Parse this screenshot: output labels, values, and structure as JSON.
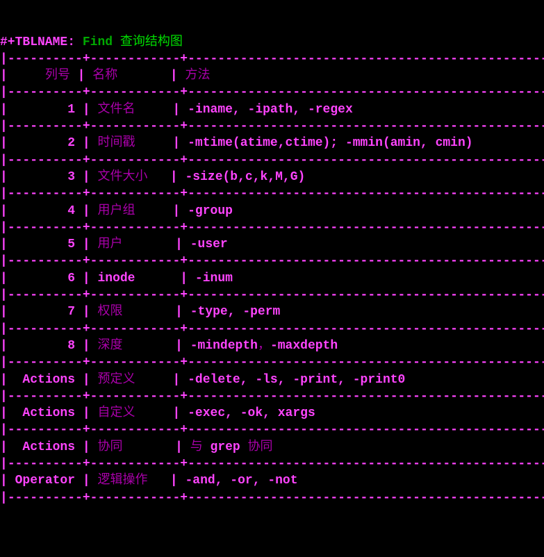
{
  "header": {
    "prefix": "#+TBLNAME:",
    "name": "Find",
    "title": "查询结构图"
  },
  "table": {
    "headers": {
      "c1": "列号",
      "c2": "名称",
      "c3": "方法"
    },
    "rows": [
      {
        "c1": "1",
        "c2": "文件名",
        "c3_a": "-iname, -ipath, -regex"
      },
      {
        "c1": "2",
        "c2": "时间戳",
        "c3_a": "-mtime(atime,ctime); -mmin(amin, cmin)"
      },
      {
        "c1": "3",
        "c2": "文件大小",
        "c3_a": "-size(b,c,k,M,G)"
      },
      {
        "c1": "4",
        "c2": "用户组",
        "c3_a": "-group"
      },
      {
        "c1": "5",
        "c2": "用户",
        "c3_a": "-user"
      },
      {
        "c1": "6",
        "c2": "inode",
        "c3_a": "-inum"
      },
      {
        "c1": "7",
        "c2": "权限",
        "c3_a": "-type, -perm"
      },
      {
        "c1": "8",
        "c2": "深度",
        "c3_a": "-mindepth",
        "c3_b": "，",
        "c3_c": "-maxdepth"
      },
      {
        "c1": "Actions",
        "c2": "预定义",
        "c3_a": "-delete, -ls, -print, -print0"
      },
      {
        "c1": "Actions",
        "c2": "自定义",
        "c3_a": "-exec, -ok, xargs"
      },
      {
        "c1": "Actions",
        "c2": "协同",
        "c3_b": "与 ",
        "c3_a": "grep",
        "c3_c": " 协同",
        "mid": true
      },
      {
        "c1": "Operator",
        "c2": "逻辑操作",
        "c3_a": "-and, -or, -not"
      }
    ]
  },
  "chart_data": {
    "type": "table",
    "title": "Find 查询结构图",
    "columns": [
      "列号",
      "名称",
      "方法"
    ],
    "rows": [
      [
        "1",
        "文件名",
        "-iname, -ipath, -regex"
      ],
      [
        "2",
        "时间戳",
        "-mtime(atime,ctime); -mmin(amin, cmin)"
      ],
      [
        "3",
        "文件大小",
        "-size(b,c,k,M,G)"
      ],
      [
        "4",
        "用户组",
        "-group"
      ],
      [
        "5",
        "用户",
        "-user"
      ],
      [
        "6",
        "inode",
        "-inum"
      ],
      [
        "7",
        "权限",
        "-type, -perm"
      ],
      [
        "8",
        "深度",
        "-mindepth，-maxdepth"
      ],
      [
        "Actions",
        "预定义",
        "-delete, -ls, -print, -print0"
      ],
      [
        "Actions",
        "自定义",
        "-exec, -ok, xargs"
      ],
      [
        "Actions",
        "协同",
        "与 grep 协同"
      ],
      [
        "Operator",
        "逻辑操作",
        "-and, -or, -not"
      ]
    ]
  }
}
